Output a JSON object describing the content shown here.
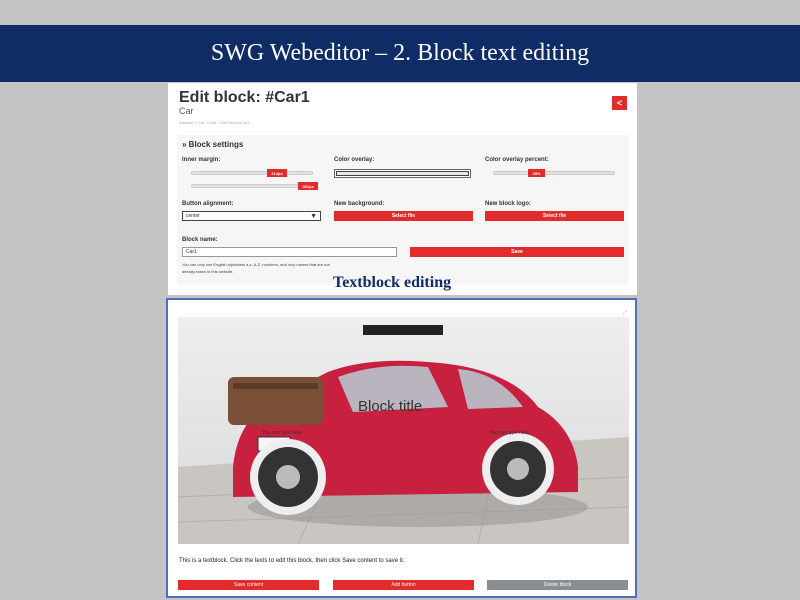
{
  "banner": {
    "title": "SWG Webeditor – 2. Block text editing"
  },
  "panel": {
    "title": "Edit block: #Car1",
    "subtitle": "Car",
    "back_label": "<",
    "breadcrumb": "Website > Car > Edit > Edit block #Car1"
  },
  "settings": {
    "heading": "» Block settings",
    "inner_margin": {
      "label": "Inner margin:",
      "value1": "214px",
      "value2": "391px"
    },
    "color_overlay": {
      "label": "Color overlay:"
    },
    "overlay_percent": {
      "label": "Color overlay percent:",
      "value": "35%"
    },
    "button_alignment": {
      "label": "Button alignment:",
      "selected": "center"
    },
    "new_background": {
      "label": "New background:",
      "button": "Select file"
    },
    "new_logo": {
      "label": "New block logo:",
      "button": "Select file"
    },
    "block_name": {
      "label": "Block name:",
      "value": "Car1",
      "save": "Save",
      "hint_line1": "You can only use English alphabets a-z, A-Z, numbers, and only names that are not",
      "hint_line2": "already taken in this website."
    }
  },
  "caption": "Textblock editing",
  "editor": {
    "resize_mark": "⤢",
    "block_title": "Block title",
    "type_left": "You can type here",
    "type_right": "You can type here",
    "description": "This is a textblock. Click the texts to edit this block, then click Save content to save it.",
    "save_content": "Save content",
    "add_button": "Add button",
    "delete_block": "Delete block"
  },
  "icons": {
    "dropdown": "caret-down-icon"
  },
  "colors": {
    "banner": "#0f2c66",
    "accent": "#e32b2b",
    "grey_button": "#8a8d91",
    "frame": "#4b72b5"
  }
}
